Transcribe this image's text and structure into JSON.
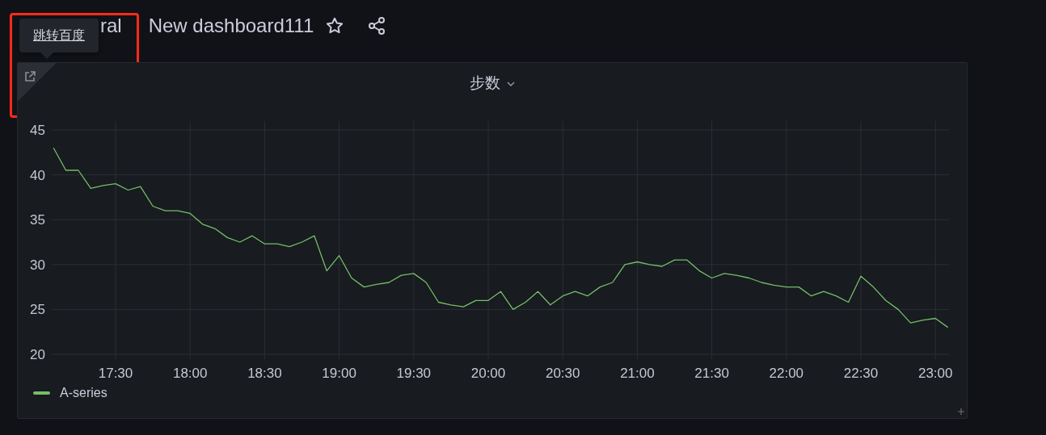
{
  "header": {
    "breadcrumb": [
      "ral",
      "New dashboard111"
    ],
    "tooltip": "跳转百度"
  },
  "panel": {
    "title": "步数",
    "chart_data": {
      "type": "line",
      "categories": [
        null,
        null,
        null,
        null,
        null,
        "17:30",
        null,
        null,
        null,
        null,
        null,
        "18:00",
        null,
        null,
        null,
        null,
        null,
        "18:30",
        null,
        null,
        null,
        null,
        null,
        "19:00",
        null,
        null,
        null,
        null,
        null,
        "19:30",
        null,
        null,
        null,
        null,
        null,
        "20:00",
        null,
        null,
        null,
        null,
        null,
        "20:30",
        null,
        null,
        null,
        null,
        null,
        "21:00",
        null,
        null,
        null,
        null,
        null,
        "21:30",
        null,
        null,
        null,
        null,
        null,
        "22:00",
        null,
        null,
        null,
        null,
        null,
        "22:30",
        null,
        null,
        null,
        null,
        null,
        "23:00",
        null
      ],
      "series": [
        {
          "name": "A-series",
          "color": "#73bf69",
          "values": [
            43,
            40.5,
            40.5,
            38.5,
            38.8,
            39,
            38.3,
            38.7,
            36.5,
            36,
            36,
            35.7,
            34.5,
            34,
            33,
            32.5,
            33.2,
            32.3,
            32.3,
            32,
            32.5,
            33.2,
            29.3,
            31,
            28.5,
            27.5,
            27.8,
            28,
            28.8,
            29,
            28,
            25.8,
            25.5,
            25.3,
            26,
            26,
            27,
            25,
            25.8,
            27,
            25.5,
            26.5,
            27,
            26.5,
            27.5,
            28,
            30,
            30.3,
            30,
            29.8,
            30.5,
            30.5,
            29.3,
            28.5,
            29,
            28.8,
            28.5,
            28,
            27.7,
            27.5,
            27.5,
            26.5,
            27,
            26.5,
            25.8,
            28.7,
            27.5,
            26,
            25,
            23.5,
            23.8,
            24,
            23
          ]
        }
      ],
      "grid": true,
      "ylim": [
        20,
        45
      ],
      "yticks": [
        20,
        25,
        30,
        35,
        40,
        45
      ]
    }
  }
}
